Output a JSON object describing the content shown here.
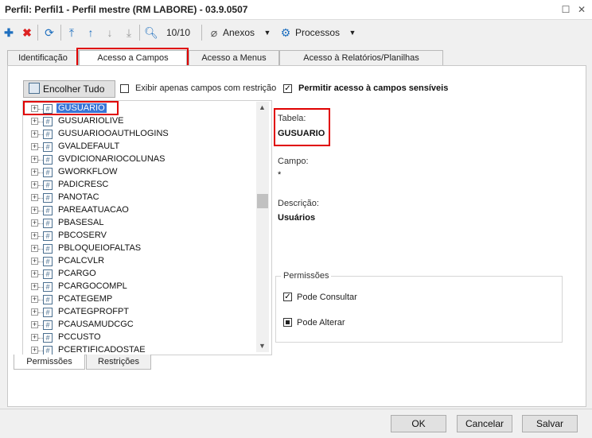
{
  "window": {
    "title": "Perfil: Perfil1 - Perfil mestre (RM LABORE) - 03.9.0507"
  },
  "toolbar": {
    "record_counter": "10/10",
    "anexos_label": "Anexos",
    "processos_label": "Processos"
  },
  "tabs": [
    {
      "label": "Identificação"
    },
    {
      "label": "Acesso a Campos"
    },
    {
      "label": "Acesso a Menus"
    },
    {
      "label": "Acesso à Relatórios/Planilhas"
    }
  ],
  "options": {
    "collapse_all": "Encolher Tudo",
    "only_restricted": "Exibir apenas campos com restrição",
    "sensitive_access": "Permitir acesso à campos sensíveis"
  },
  "tree": {
    "items": [
      "GUSUARIO",
      "GUSUARIOLIVE",
      "GUSUARIOOAUTHLOGINS",
      "GVALDEFAULT",
      "GVDICIONARIOCOLUNAS",
      "GWORKFLOW",
      "PADICRESC",
      "PANOTAC",
      "PAREAATUACAO",
      "PBASESAL",
      "PBCOSERV",
      "PBLOQUEIOFALTAS",
      "PCALCVLR",
      "PCARGO",
      "PCARGOCOMPL",
      "PCATEGEMP",
      "PCATEGPROFPT",
      "PCAUSAMUDCGC",
      "PCCUSTO",
      "PCERTIFICADOSTAE"
    ]
  },
  "detail": {
    "tabela_label": "Tabela:",
    "tabela_value": "GUSUARIO",
    "campo_label": "Campo:",
    "campo_value": "*",
    "descricao_label": "Descrição:",
    "descricao_value": "Usuários"
  },
  "permissions": {
    "title": "Permissões",
    "consultar": "Pode Consultar",
    "alterar": "Pode Alterar"
  },
  "bottom_tabs": [
    {
      "label": "Permissões"
    },
    {
      "label": "Restrições"
    }
  ],
  "buttons": {
    "ok": "OK",
    "cancel": "Cancelar",
    "save": "Salvar"
  }
}
